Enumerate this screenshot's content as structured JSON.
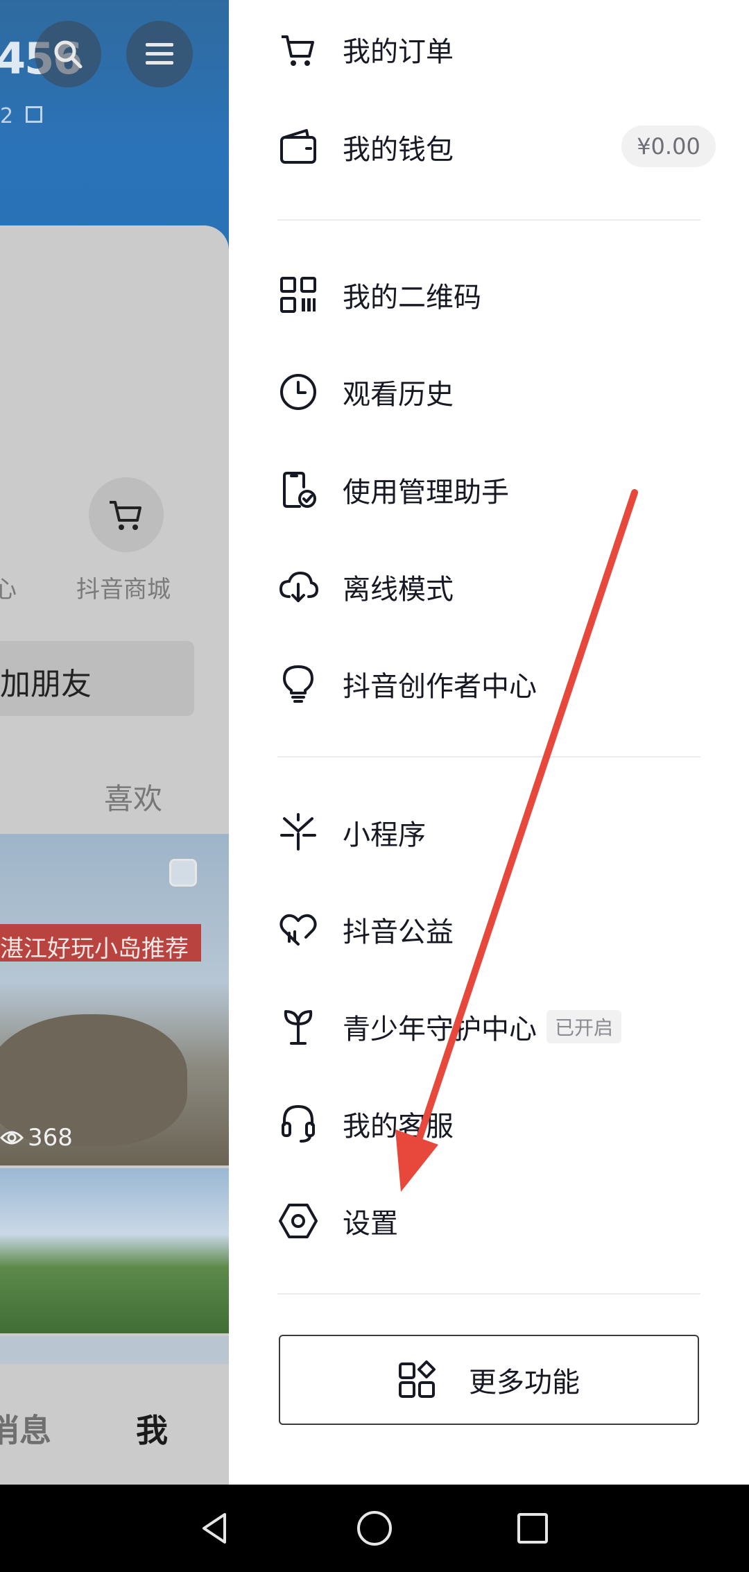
{
  "left_page": {
    "account_number_partial": "456",
    "account_sub_partial": "2",
    "mall_label": "抖音商城",
    "cut_label_partial": "心",
    "add_friend_partial": "加朋友",
    "like_tab": "喜欢",
    "thumb_banner_text": "湛江好玩小岛推荐",
    "thumb_views": "368",
    "nav_messages_partial": "消息",
    "nav_me": "我"
  },
  "drawer": {
    "orders": "我的订单",
    "wallet": "我的钱包",
    "wallet_balance": "¥0.00",
    "qrcode": "我的二维码",
    "history": "观看历史",
    "usage_manager": "使用管理助手",
    "offline_mode": "离线模式",
    "creator_center": "抖音创作者中心",
    "mini_programs": "小程序",
    "charity": "抖音公益",
    "youth_center": "青少年守护中心",
    "youth_status": "已开启",
    "customer_service": "我的客服",
    "settings": "设置",
    "more_features": "更多功能"
  },
  "annotation": {
    "arrow_color": "#e8473b"
  },
  "colors": {
    "header_blue": "#2b73b8",
    "text": "#161823"
  }
}
